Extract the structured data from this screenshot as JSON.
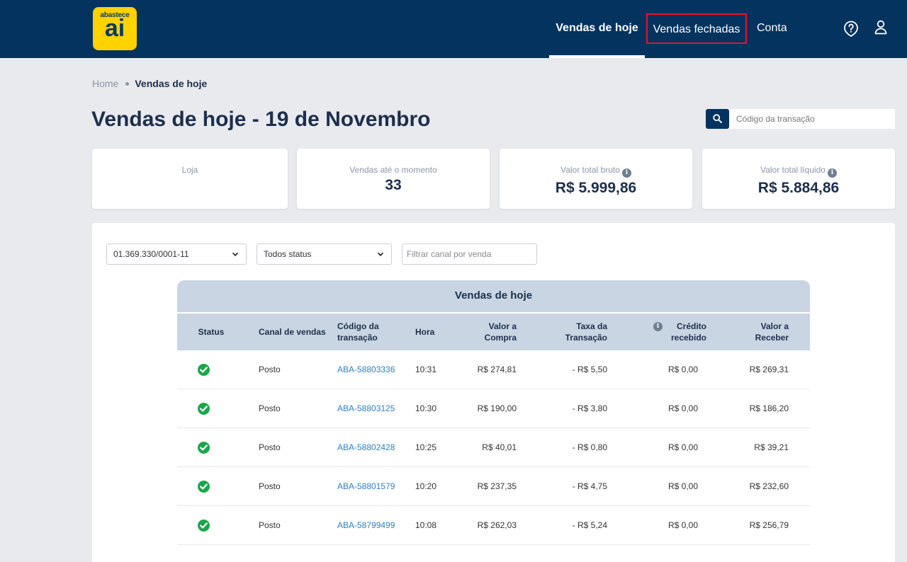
{
  "header": {
    "logo_top": "abastece",
    "logo_bottom": "ai",
    "nav": {
      "today": "Vendas de hoje",
      "closed": "Vendas fechadas",
      "account": "Conta"
    }
  },
  "breadcrumb": {
    "home": "Home",
    "current": "Vendas de hoje"
  },
  "page_title": "Vendas de hoje - 19 de Novembro",
  "search": {
    "placeholder": "Código da transação"
  },
  "cards": {
    "store": {
      "label": "Loja"
    },
    "sales": {
      "label": "Vendas até o momento",
      "value": "33"
    },
    "gross": {
      "label": "Valor total bruto",
      "value": "R$ 5.999,86"
    },
    "net": {
      "label": "Valor total líquido",
      "value": "R$ 5.884,86"
    }
  },
  "filters": {
    "cnpj": "01.369.330/0001-11",
    "status": "Todos status",
    "channel_placeholder": "Filtrar canal por venda"
  },
  "table": {
    "caption": "Vendas de hoje",
    "columns": {
      "status": "Status",
      "canal": "Canal de vendas",
      "codigo": "Código da transação",
      "hora": "Hora",
      "compra": "Valor a Compra",
      "taxa": "Taxa da Transação",
      "credito": "Crédito recebido",
      "receber": "Valor a Receber"
    },
    "rows": [
      {
        "canal": "Posto",
        "codigo": "ABA-58803336",
        "hora": "10:31",
        "compra": "R$ 274,81",
        "taxa": "- R$ 5,50",
        "credito": "R$ 0,00",
        "receber": "R$ 269,31"
      },
      {
        "canal": "Posto",
        "codigo": "ABA-58803125",
        "hora": "10:30",
        "compra": "R$ 190,00",
        "taxa": "- R$ 3,80",
        "credito": "R$ 0,00",
        "receber": "R$ 186,20"
      },
      {
        "canal": "Posto",
        "codigo": "ABA-58802428",
        "hora": "10:25",
        "compra": "R$ 40,01",
        "taxa": "- R$ 0,80",
        "credito": "R$ 0,00",
        "receber": "R$ 39,21"
      },
      {
        "canal": "Posto",
        "codigo": "ABA-58801579",
        "hora": "10:20",
        "compra": "R$ 237,35",
        "taxa": "- R$ 4,75",
        "credito": "R$ 0,00",
        "receber": "R$ 232,60"
      },
      {
        "canal": "Posto",
        "codigo": "ABA-58799499",
        "hora": "10:08",
        "compra": "R$ 262,03",
        "taxa": "- R$ 5,24",
        "credito": "R$ 0,00",
        "receber": "R$ 256,79"
      }
    ]
  },
  "colors": {
    "navy": "#03335e",
    "accent_yellow": "#ffd200",
    "status_ok": "#1aa64a",
    "link": "#2f7fc1",
    "highlight_red": "#e3142a"
  }
}
